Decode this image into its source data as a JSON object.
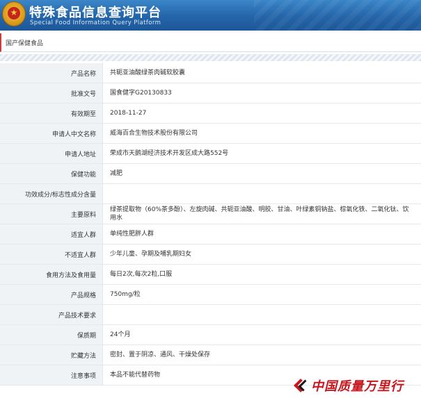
{
  "header": {
    "title": "特殊食品信息查询平台",
    "subtitle": "Special Food Information Query Platform",
    "colors": {
      "primary": "#2464a8",
      "accent": "#d23a3a"
    }
  },
  "breadcrumb": "国产保健食品",
  "detail": {
    "rows": [
      {
        "label": "产品名称",
        "value": "共轭亚油酸绿茶肉碱软胶囊"
      },
      {
        "label": "批准文号",
        "value": "国食健字G20130833"
      },
      {
        "label": "有效期至",
        "value": "2018-11-27"
      },
      {
        "label": "申请人中文名称",
        "value": "威海百合生物技术股份有限公司"
      },
      {
        "label": "申请人地址",
        "value": "荣成市天鹅湖经济技术开发区成大路552号"
      },
      {
        "label": "保健功能",
        "value": "减肥"
      },
      {
        "label": "功效成分/标志性成分含量",
        "value": ""
      },
      {
        "label": "主要原料",
        "value": "绿茶提取物（60%茶多酚）、左旋肉碱、共轭亚油酸、明胶、甘油、叶绿素铜钠盐、棕氧化铁、二氧化钛、饮用水"
      },
      {
        "label": "适宜人群",
        "value": "单纯性肥胖人群"
      },
      {
        "label": "不适宜人群",
        "value": "少年儿童、孕期及哺乳期妇女"
      },
      {
        "label": "食用方法及食用量",
        "value": "每日2次,每次2粒,口服"
      },
      {
        "label": "产品规格",
        "value": "750mg/粒"
      },
      {
        "label": "产品技术要求",
        "value": ""
      },
      {
        "label": "保质期",
        "value": "24个月"
      },
      {
        "label": "贮藏方法",
        "value": "密封、置于阴凉、通风、干燥处保存"
      },
      {
        "label": "注意事项",
        "value": "本品不能代替药物"
      }
    ]
  },
  "watermark": {
    "text": "中国质量万里行",
    "color": "#c8161d"
  },
  "icons": {
    "emblem": "national-emblem-icon",
    "watermark_logo": "cqn-logo-icon"
  }
}
